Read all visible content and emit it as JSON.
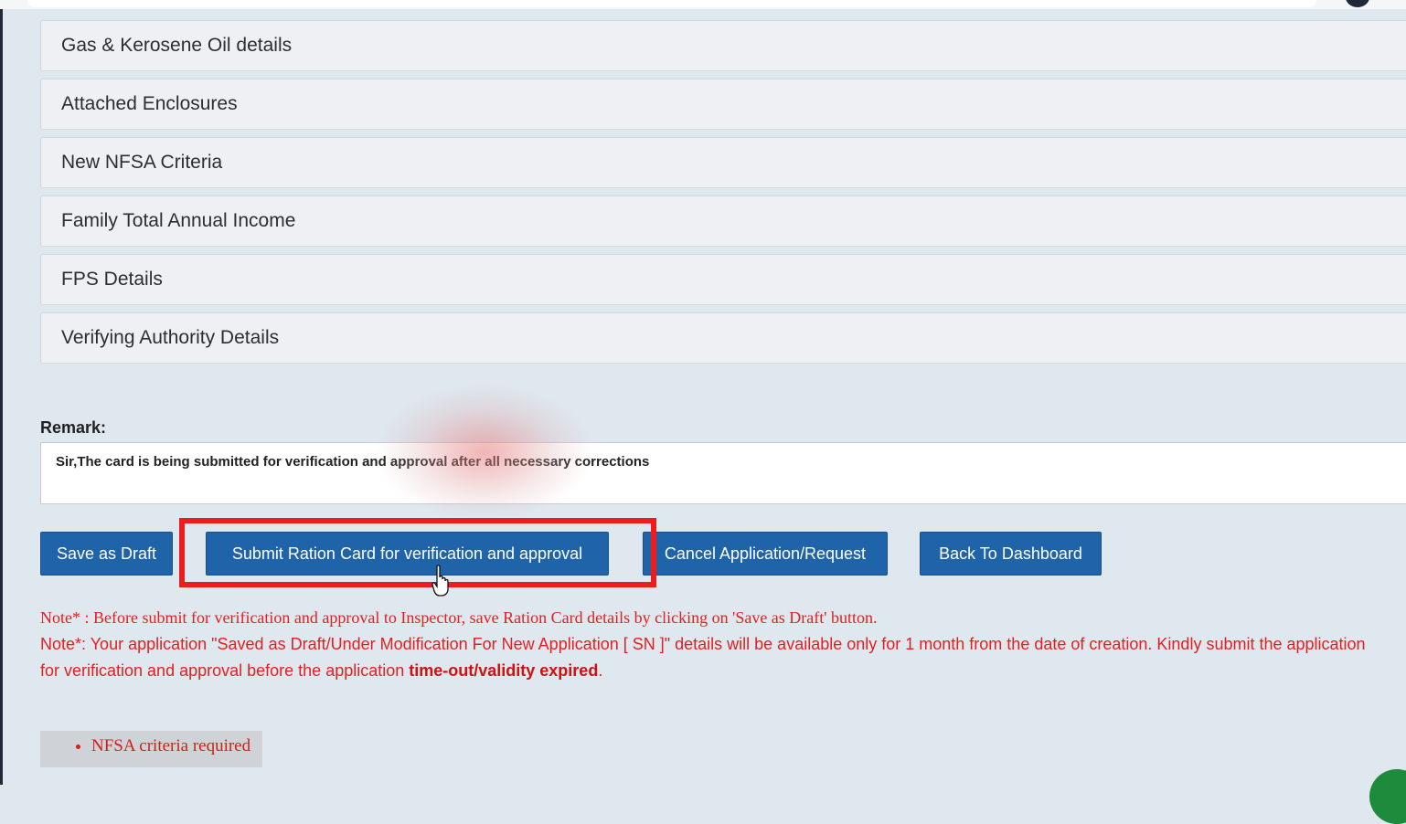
{
  "sections": [
    {
      "label": "Gas & Kerosene Oil details"
    },
    {
      "label": "Attached Enclosures"
    },
    {
      "label": "New NFSA Criteria"
    },
    {
      "label": "Family Total Annual Income"
    },
    {
      "label": "FPS Details"
    },
    {
      "label": "Verifying Authority Details"
    }
  ],
  "remark": {
    "label": "Remark:",
    "value": "Sir,The card is being submitted for verification and approval after all necessary corrections"
  },
  "buttons": {
    "save_draft": "Save as Draft",
    "submit": "Submit Ration Card for verification and approval",
    "cancel": "Cancel Application/Request",
    "back": "Back To Dashboard"
  },
  "notes": {
    "note1": "Note* : Before submit for verification and approval to Inspector, save Ration Card details by clicking on 'Save as Draft' button.",
    "note2_prefix": "Note*: Your application \"Saved as Draft/Under Modification For New Application [ SN ]\" details will be available only for 1 month from the date of creation. Kindly submit the application for verification and approval before the application ",
    "note2_emphasis": "time-out/validity expired",
    "note2_suffix": "."
  },
  "errors": [
    "NFSA criteria required"
  ],
  "colors": {
    "button_blue": "#1f63a8",
    "highlight_red": "#ee1c1c",
    "note_red": "#e32020"
  }
}
